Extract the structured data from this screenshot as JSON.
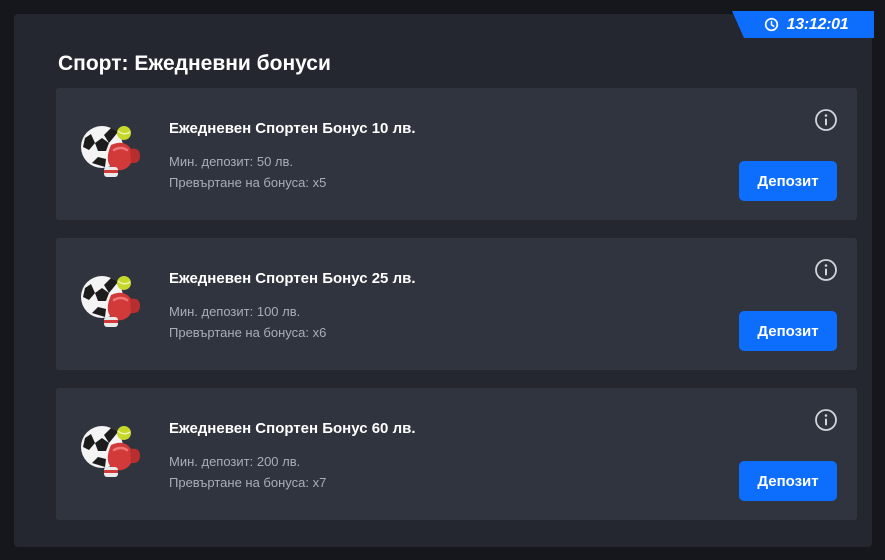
{
  "timer": {
    "text": "13:12:01",
    "icon": "clock-icon"
  },
  "page": {
    "title": "Спорт: Ежедневни бонуси"
  },
  "bonuses": [
    {
      "title": "Ежедневен Спортен Бонус 10 лв.",
      "min_deposit": "Мин. депозит: 50 лв.",
      "rollover": "Превъртане на бонуса: x5",
      "button": "Депозит",
      "icon": "sports-ball-glove-icon"
    },
    {
      "title": "Ежедневен Спортен Бонус 25 лв.",
      "min_deposit": "Мин. депозит: 100 лв.",
      "rollover": "Превъртане на бонуса: x6",
      "button": "Депозит",
      "icon": "sports-ball-glove-icon"
    },
    {
      "title": "Ежедневен Спортен Бонус 60 лв.",
      "min_deposit": "Мин. депозит: 200 лв.",
      "rollover": "Превъртане на бонуса: x7",
      "button": "Депозит",
      "icon": "sports-ball-glove-icon"
    }
  ],
  "colors": {
    "background": "#16171c",
    "panel": "#24272f",
    "card": "#30343e",
    "accent": "#0d6efd",
    "muted_text": "#a9adb6"
  }
}
